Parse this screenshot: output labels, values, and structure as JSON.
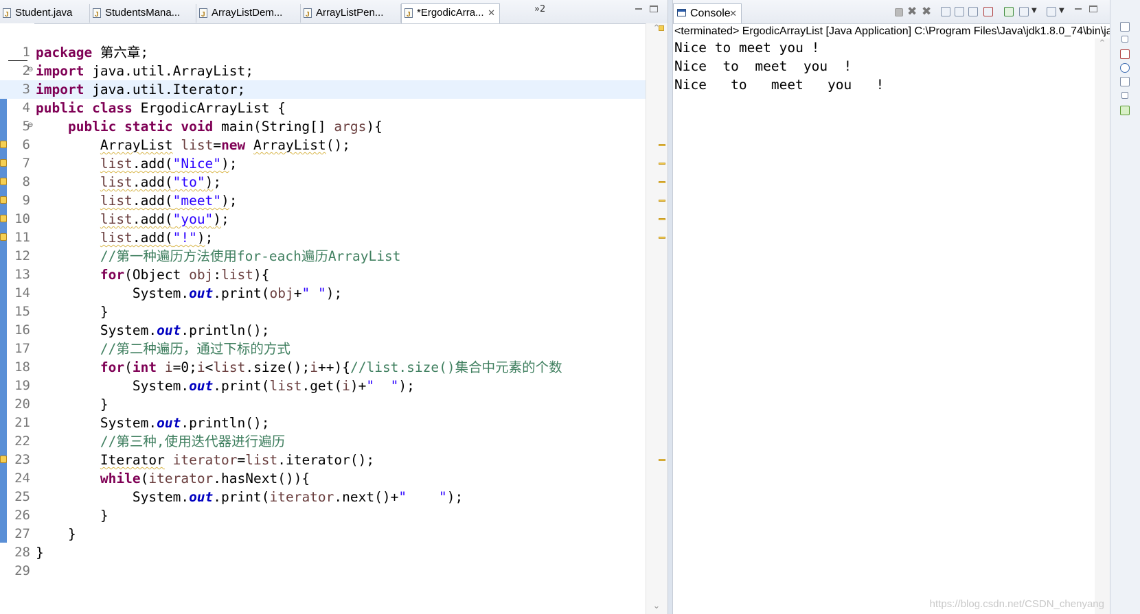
{
  "editor": {
    "tabs": [
      {
        "label": "Student.java",
        "active": false
      },
      {
        "label": "StudentsMana...",
        "active": false
      },
      {
        "label": "ArrayListDem...",
        "active": false
      },
      {
        "label": "ArrayListPen...",
        "active": false
      },
      {
        "label": "*ErgodicArra...",
        "active": true
      }
    ],
    "overflow_label": "»2",
    "lines": [
      {
        "n": "1",
        "html": "<span class=\"kw\">package</span> 第六章;"
      },
      {
        "n": "2",
        "fold": "⊖",
        "html": "<span class=\"kw\">import</span> java.util.ArrayList;"
      },
      {
        "n": "3",
        "current": true,
        "html": "<span class=\"kw\">import</span> java.util.Iterator;"
      },
      {
        "n": "4",
        "html": "<span class=\"kw\">public class</span> ErgodicArrayList {"
      },
      {
        "n": "5",
        "fold": "⊖",
        "html": "    <span class=\"kw\">public static void</span> main(String[] <span class=\"var\">args</span>){"
      },
      {
        "n": "6",
        "warn": true,
        "html": "        <span class=\"sq\">ArrayList</span> <span class=\"var\">list</span>=<span class=\"kw\">new</span> <span class=\"sq\">ArrayList</span>();"
      },
      {
        "n": "7",
        "warn": true,
        "html": "        <span class=\"sq\"><span class=\"var\">list</span>.add(<span class=\"str\">\"Nice\"</span>)</span>;"
      },
      {
        "n": "8",
        "warn": true,
        "html": "        <span class=\"sq\"><span class=\"var\">list</span>.add(<span class=\"str\">\"to\"</span>)</span>;"
      },
      {
        "n": "9",
        "warn": true,
        "html": "        <span class=\"sq\"><span class=\"var\">list</span>.add(<span class=\"str\">\"meet\"</span>)</span>;"
      },
      {
        "n": "10",
        "warn": true,
        "html": "        <span class=\"sq\"><span class=\"var\">list</span>.add(<span class=\"str\">\"you\"</span>)</span>;"
      },
      {
        "n": "11",
        "warn": true,
        "html": "        <span class=\"sq\"><span class=\"var\">list</span>.add(<span class=\"str\">\"!\"</span>)</span>;"
      },
      {
        "n": "12",
        "html": "        <span class=\"cm\">//第一种遍历方法使用for-each遍历ArrayList</span>"
      },
      {
        "n": "13",
        "html": "        <span class=\"kw\">for</span>(Object <span class=\"var\">obj</span>:<span class=\"var\">list</span>){"
      },
      {
        "n": "14",
        "html": "            System.<span class=\"fld\">out</span>.print(<span class=\"var\">obj</span>+<span class=\"str\">\" \"</span>);"
      },
      {
        "n": "15",
        "html": "        }"
      },
      {
        "n": "16",
        "html": "        System.<span class=\"fld\">out</span>.println();"
      },
      {
        "n": "17",
        "html": "        <span class=\"cm\">//第二种遍历，通过下标的方式</span>"
      },
      {
        "n": "18",
        "html": "        <span class=\"kw\">for</span>(<span class=\"kw\">int</span> <span class=\"var\">i</span>=0;<span class=\"var\">i</span>&lt;<span class=\"var\">list</span>.size();<span class=\"var\">i</span>++){<span class=\"cm\">//list.size()集合中元素的个数</span>"
      },
      {
        "n": "19",
        "html": "            System.<span class=\"fld\">out</span>.print(<span class=\"var\">list</span>.get(<span class=\"var\">i</span>)+<span class=\"str\">\"  \"</span>);"
      },
      {
        "n": "20",
        "html": "        }"
      },
      {
        "n": "21",
        "html": "        System.<span class=\"fld\">out</span>.println();"
      },
      {
        "n": "22",
        "html": "        <span class=\"cm\">//第三种,使用迭代器进行遍历</span>"
      },
      {
        "n": "23",
        "warn": true,
        "html": "        <span class=\"sq\">Iterator</span> <span class=\"var\">iterator</span>=<span class=\"var\">list</span>.iterator();"
      },
      {
        "n": "24",
        "html": "        <span class=\"kw\">while</span>(<span class=\"var\">iterator</span>.hasNext()){"
      },
      {
        "n": "25",
        "html": "            System.<span class=\"fld\">out</span>.print(<span class=\"var\">iterator</span>.next()+<span class=\"str\">\"    \"</span>);"
      },
      {
        "n": "26",
        "html": "        }"
      },
      {
        "n": "27",
        "html": "    }"
      },
      {
        "n": "28",
        "html": "}"
      },
      {
        "n": "29",
        "html": ""
      }
    ]
  },
  "console": {
    "tab_label": "Console",
    "status": "<terminated> ErgodicArrayList [Java Application] C:\\Program Files\\Java\\jdk1.8.0_74\\bin\\ja",
    "output": [
      "Nice to meet you !",
      "Nice  to  meet  you  !",
      "Nice   to   meet   you   !"
    ],
    "watermark": "https://blog.csdn.net/CSDN_chenyang"
  },
  "colors": {
    "keyword": "#7f0055",
    "string": "#2a00ff",
    "comment": "#3f7f5f",
    "static_field": "#0000c0",
    "local_variable": "#6a3e3e",
    "current_line": "#e8f2fe",
    "warning": "#f5cf53"
  },
  "icons": [
    "java-file-icon",
    "console-icon",
    "terminate-icon",
    "remove-launch-icon",
    "scroll-lock-icon",
    "pin-console-icon",
    "open-console-icon",
    "minimize-icon",
    "maximize-icon"
  ]
}
